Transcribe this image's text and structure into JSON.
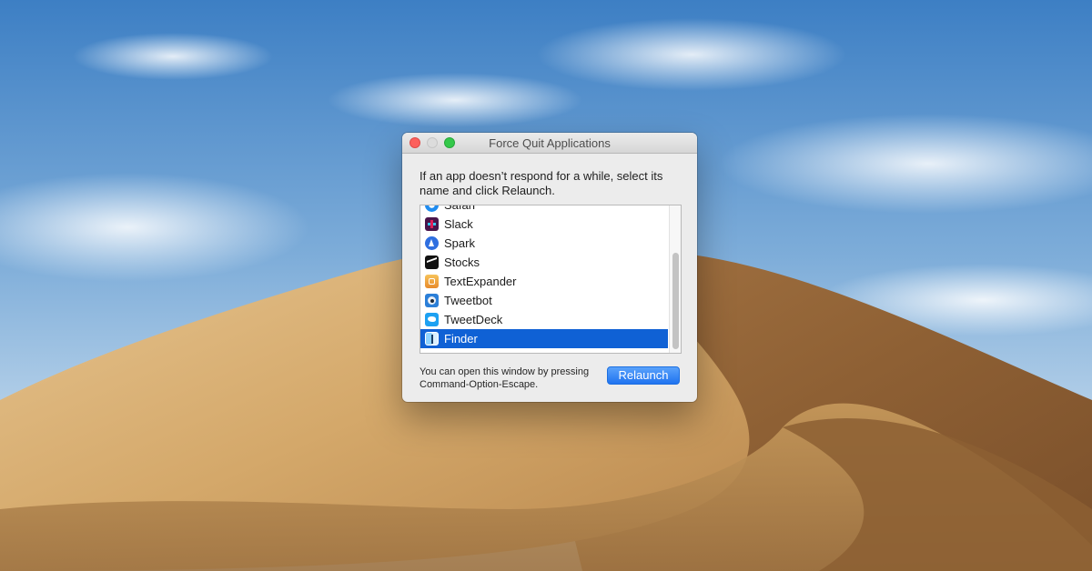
{
  "window": {
    "title": "Force Quit Applications",
    "instructions": "If an app doesn’t respond for a while, select its name and click Relaunch.",
    "footer_note": "You can open this window by pressing Command-Option-Escape.",
    "relaunch_label": "Relaunch"
  },
  "apps": [
    {
      "name": "Safari",
      "icon": "safari-icon"
    },
    {
      "name": "Slack",
      "icon": "slack-icon"
    },
    {
      "name": "Spark",
      "icon": "spark-icon"
    },
    {
      "name": "Stocks",
      "icon": "stocks-icon"
    },
    {
      "name": "TextExpander",
      "icon": "textexpander-icon"
    },
    {
      "name": "Tweetbot",
      "icon": "tweetbot-icon"
    },
    {
      "name": "TweetDeck",
      "icon": "tweetdeck-icon"
    },
    {
      "name": "Finder",
      "icon": "finder-icon",
      "selected": true
    }
  ],
  "colors": {
    "selection": "#0f61d5",
    "button": "#1f73f0",
    "close": "#fc605c",
    "zoom": "#34c84a"
  }
}
